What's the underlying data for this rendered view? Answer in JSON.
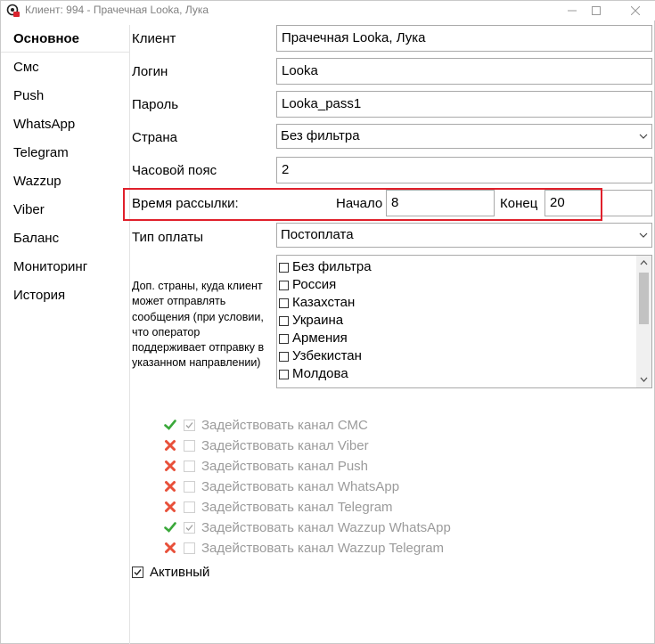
{
  "window": {
    "title": "Клиент: 994 - Прачечная Looka, Лука",
    "minimize_icon": "minimize-icon",
    "maximize_icon": "maximize-icon",
    "close_icon": "close-icon"
  },
  "sidebar": {
    "items": [
      {
        "label": "Основное",
        "active": true
      },
      {
        "label": "Смс"
      },
      {
        "label": "Push"
      },
      {
        "label": "WhatsApp"
      },
      {
        "label": "Telegram"
      },
      {
        "label": "Wazzup"
      },
      {
        "label": "Viber"
      },
      {
        "label": "Баланс"
      },
      {
        "label": "Мониторинг"
      },
      {
        "label": "История"
      }
    ]
  },
  "form": {
    "client_label": "Клиент",
    "client_value": "Прачечная Looka, Лука",
    "login_label": "Логин",
    "login_value": "Looka",
    "password_label": "Пароль",
    "password_value": "Looka_pass1",
    "country_label": "Страна",
    "country_value": "Без фильтра",
    "timezone_label": "Часовой пояс",
    "timezone_value": "2",
    "send_time_label": "Время рассылки:",
    "start_label": "Начало",
    "start_value": "8",
    "end_label": "Конец",
    "end_value": "20",
    "payment_label": "Тип оплаты",
    "payment_value": "Постоплата",
    "extra_countries_label": "Доп. страны, куда клиент может отправлять сообщения (при условии, что оператор поддерживает отправку в указанном направлении)",
    "countries": [
      {
        "label": "Без фильтра",
        "checked": false
      },
      {
        "label": "Россия",
        "checked": false
      },
      {
        "label": "Казахстан",
        "checked": false
      },
      {
        "label": "Украина",
        "checked": false
      },
      {
        "label": "Армения",
        "checked": false
      },
      {
        "label": "Узбекистан",
        "checked": false
      },
      {
        "label": "Молдова",
        "checked": false
      }
    ]
  },
  "channels": [
    {
      "label": "Задействовать канал СМС",
      "status": "ok",
      "checked": true
    },
    {
      "label": "Задействовать канал Viber",
      "status": "error",
      "checked": false
    },
    {
      "label": "Задействовать канал Push",
      "status": "error",
      "checked": false
    },
    {
      "label": "Задействовать канал WhatsApp",
      "status": "error",
      "checked": false
    },
    {
      "label": "Задействовать канал Telegram",
      "status": "error",
      "checked": false
    },
    {
      "label": "Задействовать канал Wazzup WhatsApp",
      "status": "ok",
      "checked": true
    },
    {
      "label": "Задействовать канал Wazzup Telegram",
      "status": "error",
      "checked": false
    }
  ],
  "active": {
    "label": "Активный",
    "checked": true
  },
  "colors": {
    "highlight": "#e0202b",
    "ok": "#3aa83a",
    "error": "#e8503a",
    "disabled_text": "#9b9b9b"
  }
}
